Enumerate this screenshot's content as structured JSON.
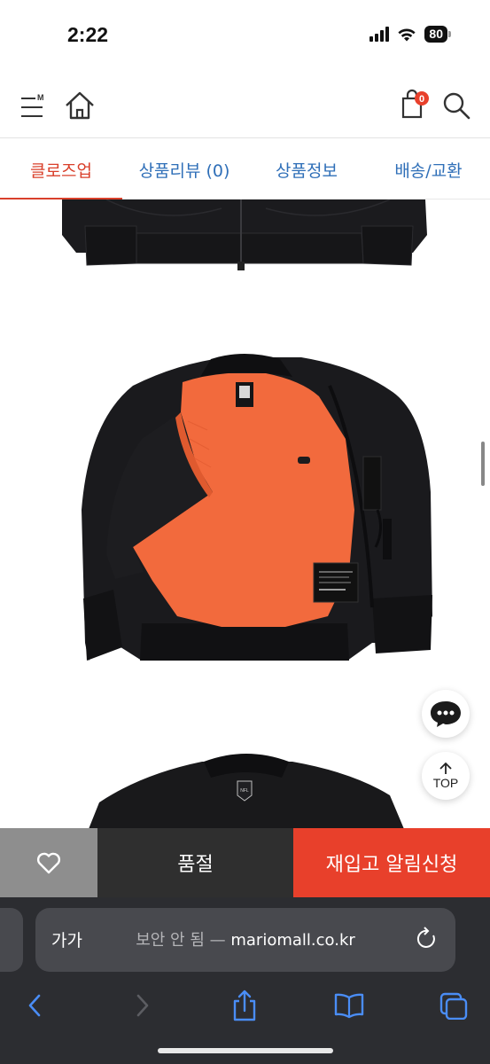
{
  "status": {
    "time": "2:22",
    "battery": "80"
  },
  "header": {
    "menu_icon": "menu-m-icon",
    "home_icon": "home-icon",
    "cart_icon": "shopping-bag-icon",
    "cart_count": "0",
    "search_icon": "search-icon"
  },
  "tabs": [
    {
      "label": "클로즈업",
      "active": true
    },
    {
      "label": "상품리뷰 (0)",
      "active": false
    },
    {
      "label": "상품정보",
      "active": false
    },
    {
      "label": "배송/교환",
      "active": false
    }
  ],
  "product_images": {
    "images": [
      "jacket-bottom-crop",
      "jacket-open-lining",
      "jacket-back-collar"
    ],
    "lining_color": "#f26a3d",
    "shell_color": "#17171a"
  },
  "floating": {
    "chat_icon": "chat-bubble-icon",
    "top_label": "TOP"
  },
  "actionbar": {
    "wish_icon": "heart-icon",
    "soldout_label": "품절",
    "restock_label": "재입고 알림신청"
  },
  "safari": {
    "aa_label": "가가",
    "insecure_label": "보안 안 됨 —",
    "domain": "mariomall.co.kr",
    "toolbar_icons": [
      "back-icon",
      "forward-icon",
      "share-icon",
      "bookmarks-icon",
      "tabs-icon"
    ]
  },
  "colors": {
    "accent": "#d9402b",
    "tab_blue": "#2f6fb8",
    "restock": "#e8402b"
  }
}
